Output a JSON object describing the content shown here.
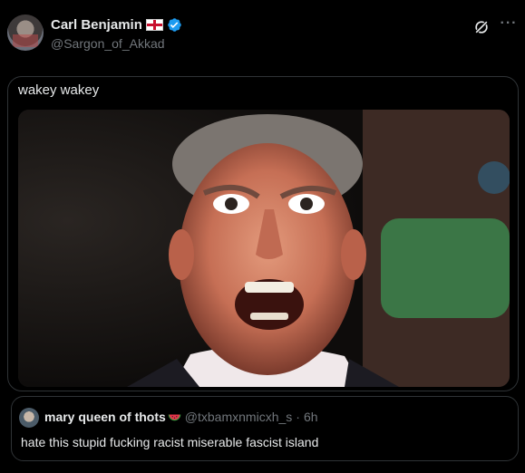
{
  "author": {
    "display_name": "Carl Benjamin",
    "handle": "@Sargon_of_Akkad",
    "flag_icon": "england-flag-icon",
    "verified_icon": "verified-badge-icon"
  },
  "header_actions": {
    "grok_icon": "grok-icon",
    "more_label": "···"
  },
  "tweet": {
    "text": "wakey wakey",
    "media_icon": "photo-of-laughing-man"
  },
  "quoted_tweet": {
    "display_name": "mary queen of thots",
    "emoji_icon": "watermelon-icon",
    "handle": "@txbamxnmicxh_s",
    "separator": "·",
    "time": "6h",
    "text": "hate this stupid fucking racist miserable fascist island"
  },
  "colors": {
    "background": "#000000",
    "text_primary": "#e7e9ea",
    "text_secondary": "#71767b",
    "border": "#2f3336",
    "verified": "#1d9bf0"
  }
}
